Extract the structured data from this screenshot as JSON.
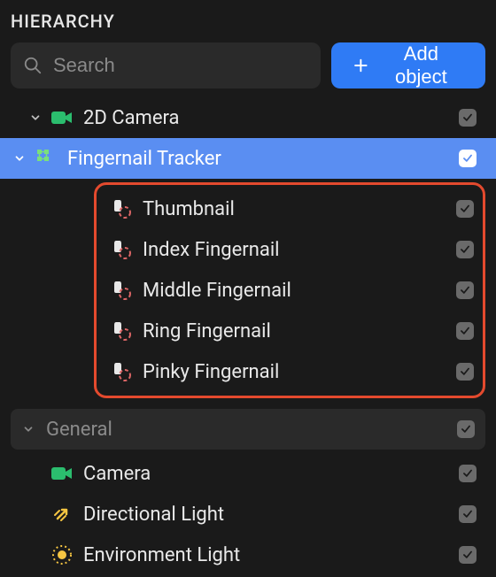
{
  "title": "HIERARCHY",
  "search": {
    "placeholder": "Search"
  },
  "add_button": {
    "label": "Add object"
  },
  "tree": {
    "camera2d": {
      "label": "2D Camera"
    },
    "tracker": {
      "label": "Fingernail Tracker"
    },
    "nails": [
      {
        "label": "Thumbnail"
      },
      {
        "label": "Index Fingernail"
      },
      {
        "label": "Middle Fingernail"
      },
      {
        "label": "Ring Fingernail"
      },
      {
        "label": "Pinky Fingernail"
      }
    ],
    "general_section": {
      "label": "General"
    },
    "general": {
      "camera": {
        "label": "Camera"
      },
      "dir_light": {
        "label": "Directional Light"
      },
      "env_light": {
        "label": "Environment Light"
      }
    }
  }
}
